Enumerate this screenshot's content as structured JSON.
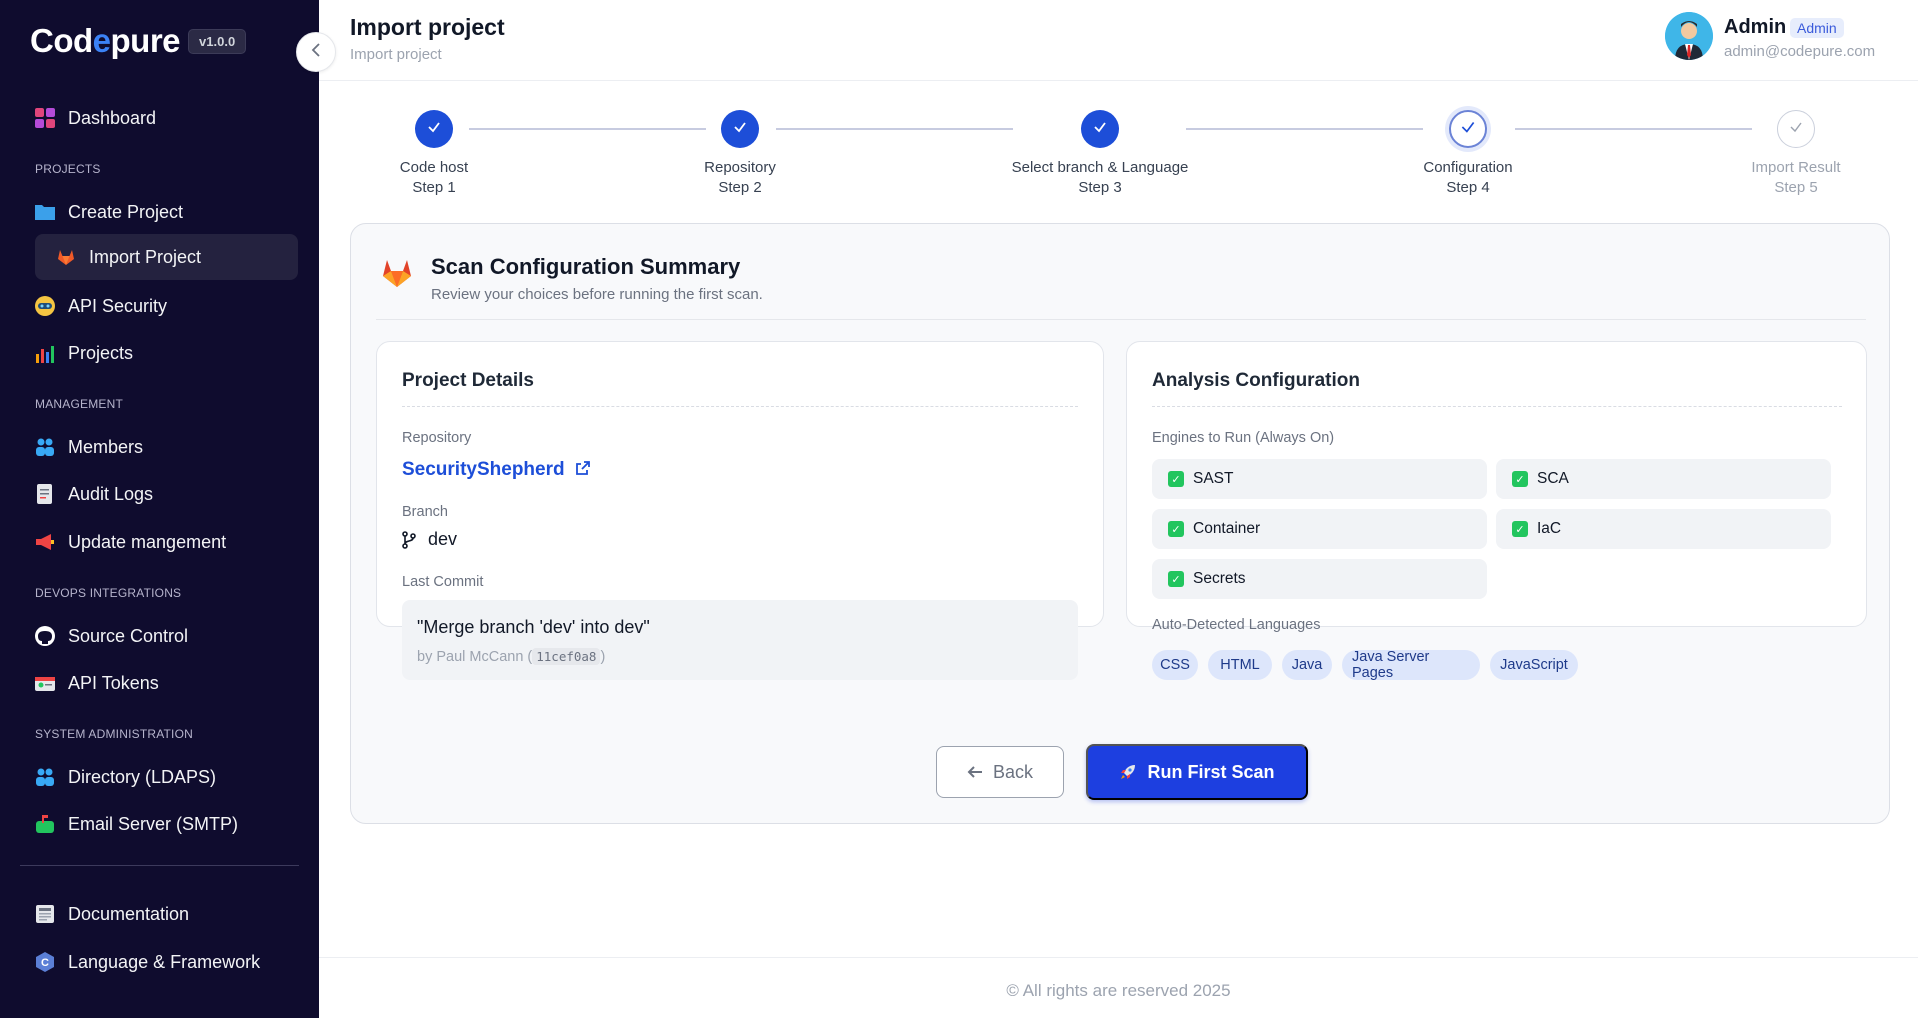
{
  "brand": {
    "name_part1": "Cod",
    "name_accent": "e",
    "name_part2": "pure",
    "version": "v1.0.0"
  },
  "sidebar": {
    "dashboard": "Dashboard",
    "section_projects": "PROJECTS",
    "create_project": "Create Project",
    "import_project": "Import Project",
    "api_security": "API Security",
    "projects": "Projects",
    "section_management": "MANAGEMENT",
    "members": "Members",
    "audit_logs": "Audit Logs",
    "update_management": "Update mangement",
    "section_devops": "DEVOPS INTEGRATIONS",
    "source_control": "Source Control",
    "api_tokens": "API Tokens",
    "section_sysadmin": "SYSTEM ADMINISTRATION",
    "directory": "Directory (LDAPS)",
    "email_server": "Email Server (SMTP)",
    "documentation": "Documentation",
    "language_framework": "Language & Framework"
  },
  "header": {
    "title": "Import project",
    "breadcrumb": "Import project",
    "user_name": "Admin",
    "user_role": "Admin",
    "user_email": "admin@codepure.com"
  },
  "stepper": {
    "steps": [
      {
        "name": "Code host",
        "step": "Step 1",
        "status": "done"
      },
      {
        "name": "Repository",
        "step": "Step 2",
        "status": "done"
      },
      {
        "name": "Select branch & Language",
        "step": "Step 3",
        "status": "done"
      },
      {
        "name": "Configuration",
        "step": "Step 4",
        "status": "current"
      },
      {
        "name": "Import Result",
        "step": "Step 5",
        "status": "todo"
      }
    ]
  },
  "summary": {
    "title": "Scan Configuration Summary",
    "subtitle": "Review your choices before running the first scan."
  },
  "project_details": {
    "title": "Project Details",
    "repository_label": "Repository",
    "repository": "SecurityShepherd",
    "branch_label": "Branch",
    "branch": "dev",
    "last_commit_label": "Last Commit",
    "commit_message": "\"Merge branch 'dev' into dev\"",
    "commit_by": "by Paul McCann (",
    "commit_hash": "11cef0a8",
    "commit_close": ")"
  },
  "analysis": {
    "title": "Analysis Configuration",
    "engines_label": "Engines to Run (Always On)",
    "engines": [
      "SAST",
      "SCA",
      "Container",
      "IaC",
      "Secrets"
    ],
    "languages_label": "Auto-Detected Languages",
    "languages": [
      "CSS",
      "HTML",
      "Java",
      "Java Server Pages",
      "JavaScript"
    ]
  },
  "actions": {
    "back": "Back",
    "run": "Run First Scan"
  },
  "footer": "© All rights are reserved 2025",
  "colors": {
    "sidebar_bg": "#0f0c2e",
    "primary": "#1d3fe0",
    "check": "#22c55e"
  }
}
